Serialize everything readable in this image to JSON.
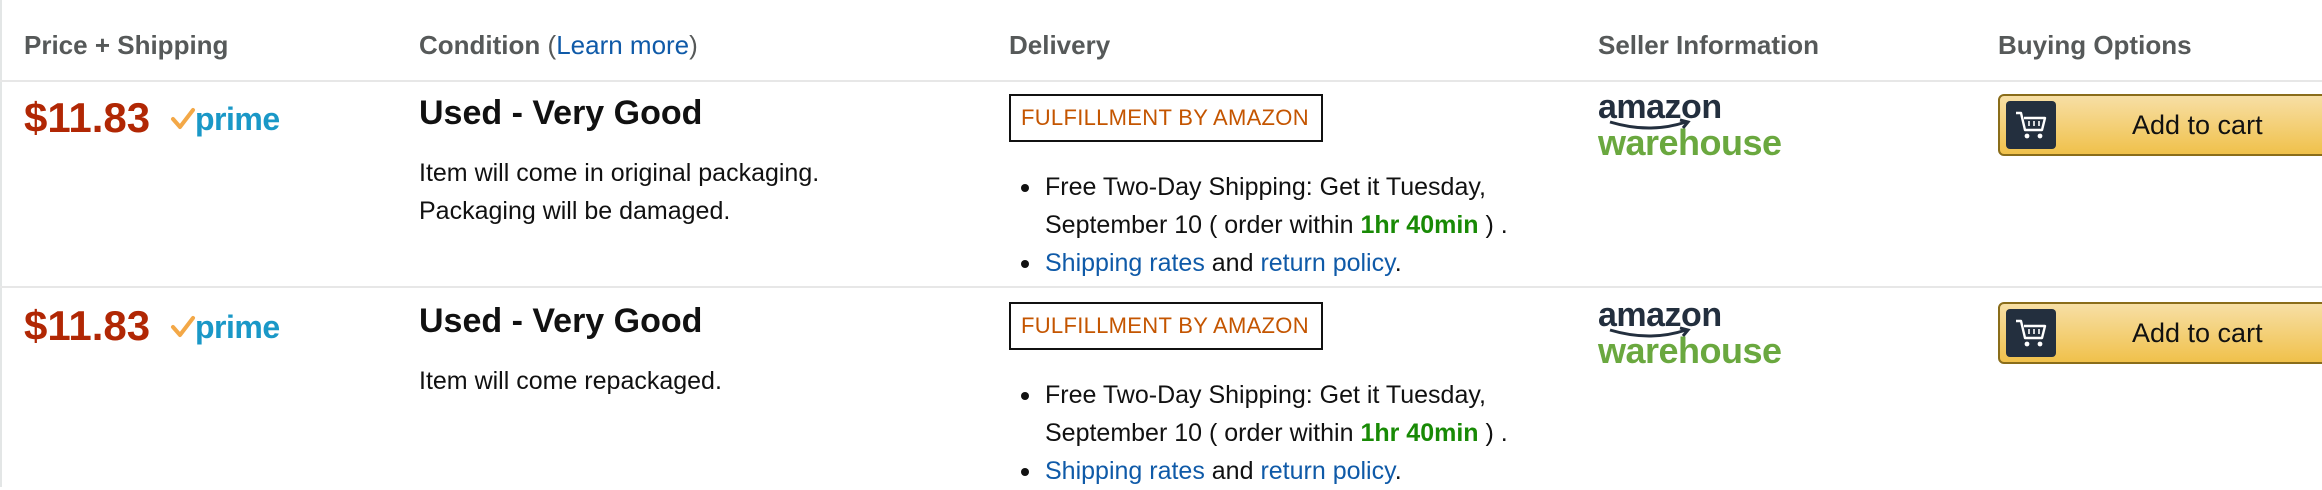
{
  "header": {
    "price_shipping": "Price + Shipping",
    "condition": "Condition",
    "learn_more": "Learn more",
    "delivery": "Delivery",
    "seller_information": "Seller Information",
    "buying_options": "Buying Options"
  },
  "offers": [
    {
      "price": "$11.83",
      "prime_label": "prime",
      "condition_title": "Used - Very Good",
      "condition_note": "Item will come in original packaging. Packaging will be damaged.",
      "fulfillment_label": "FULFILLMENT BY AMAZON",
      "shipping_line_1": "Free Two-Day Shipping: Get it Tuesday,",
      "shipping_line_2a": "September 10 ( order within ",
      "shipping_countdown": "1hr 40min",
      "shipping_line_2b": " ) .",
      "shipping_rates_link": "Shipping rates",
      "and_text": " and ",
      "return_policy_link": "return policy",
      "period": ".",
      "seller_logo_top": "amazon",
      "seller_logo_bottom": "warehouse",
      "add_to_cart": "Add to cart"
    },
    {
      "price": "$11.83",
      "prime_label": "prime",
      "condition_title": "Used - Very Good",
      "condition_note": "Item will come repackaged.",
      "fulfillment_label": "FULFILLMENT BY AMAZON",
      "shipping_line_1": "Free Two-Day Shipping: Get it Tuesday,",
      "shipping_line_2a": "September 10 ( order within ",
      "shipping_countdown": "1hr 40min",
      "shipping_line_2b": " ) .",
      "shipping_rates_link": "Shipping rates",
      "and_text": " and ",
      "return_policy_link": "return policy",
      "period": ".",
      "seller_logo_top": "amazon",
      "seller_logo_bottom": "warehouse",
      "add_to_cart": "Add to cart"
    }
  ],
  "icons": {
    "prime_check": "checkmark-icon",
    "dropdown": "chevron-down-icon",
    "cart": "cart-icon"
  },
  "colors": {
    "price": "#b12704",
    "prime": "#1a98c7",
    "prime_check": "#f3a847",
    "link": "#0f5aa8",
    "countdown": "#188a05",
    "fulfillment": "#c45500",
    "warehouse": "#6aa83f",
    "cart_button": "#f0c14b"
  }
}
